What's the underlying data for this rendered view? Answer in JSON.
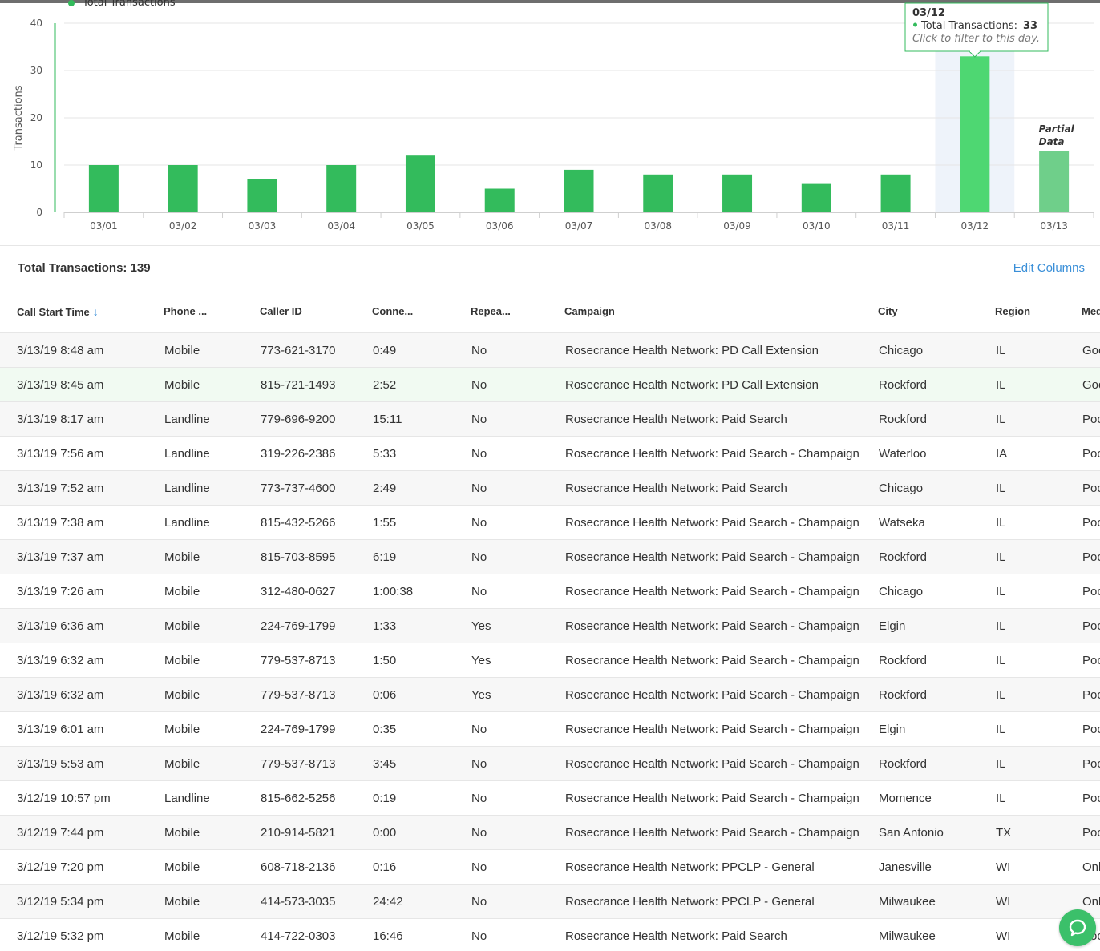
{
  "chart_data": {
    "type": "bar",
    "legend_label": "Total Transactions",
    "ylabel": "Transactions",
    "ylim": [
      0,
      40
    ],
    "yticks": [
      0,
      10,
      20,
      30,
      40
    ],
    "categories": [
      "03/01",
      "03/02",
      "03/03",
      "03/04",
      "03/05",
      "03/06",
      "03/07",
      "03/08",
      "03/09",
      "03/10",
      "03/11",
      "03/12",
      "03/13"
    ],
    "series": [
      {
        "name": "Total Transactions",
        "values": [
          10,
          10,
          7,
          10,
          12,
          5,
          9,
          8,
          8,
          6,
          8,
          33,
          13
        ]
      }
    ],
    "highlighted_category": "03/12",
    "partial_category": "03/13",
    "partial_label_line1": "Partial",
    "partial_label_line2": "Data",
    "tooltip": {
      "date": "03/12",
      "label": "Total Transactions:",
      "value": "33",
      "hint": "Click to filter to this day."
    },
    "colors": {
      "bar": "#33bb5c",
      "bar_highlight": "#4ed772",
      "bar_partial": "#6fcf8a",
      "highlight_band": "#eef3fa"
    }
  },
  "summary": {
    "total_text": "Total Transactions: 139",
    "edit_columns": "Edit Columns"
  },
  "table": {
    "columns": [
      "Call Start Time",
      "Phone ...",
      "Caller ID",
      "Conne...",
      "Repea...",
      "Campaign",
      "City",
      "Region",
      "Med"
    ],
    "sort_icon": "arrow-down-icon",
    "rows": [
      [
        "3/13/19 8:48 am",
        "Mobile",
        "773-621-3170",
        "0:49",
        "No",
        "Rosecrance Health Network: PD Call Extension",
        "Chicago",
        "IL",
        "Goo"
      ],
      [
        "3/13/19 8:45 am",
        "Mobile",
        "815-721-1493",
        "2:52",
        "No",
        "Rosecrance Health Network: PD Call Extension",
        "Rockford",
        "IL",
        "Goo"
      ],
      [
        "3/13/19 8:17 am",
        "Landline",
        "779-696-9200",
        "15:11",
        "No",
        "Rosecrance Health Network: Paid Search",
        "Rockford",
        "IL",
        "Poc"
      ],
      [
        "3/13/19 7:56 am",
        "Landline",
        "319-226-2386",
        "5:33",
        "No",
        "Rosecrance Health Network: Paid Search - Champaign",
        "Waterloo",
        "IA",
        "Poc"
      ],
      [
        "3/13/19 7:52 am",
        "Landline",
        "773-737-4600",
        "2:49",
        "No",
        "Rosecrance Health Network: Paid Search",
        "Chicago",
        "IL",
        "Poc"
      ],
      [
        "3/13/19 7:38 am",
        "Landline",
        "815-432-5266",
        "1:55",
        "No",
        "Rosecrance Health Network: Paid Search - Champaign",
        "Watseka",
        "IL",
        "Poc"
      ],
      [
        "3/13/19 7:37 am",
        "Mobile",
        "815-703-8595",
        "6:19",
        "No",
        "Rosecrance Health Network: Paid Search - Champaign",
        "Rockford",
        "IL",
        "Poc"
      ],
      [
        "3/13/19 7:26 am",
        "Mobile",
        "312-480-0627",
        "1:00:38",
        "No",
        "Rosecrance Health Network: Paid Search - Champaign",
        "Chicago",
        "IL",
        "Poc"
      ],
      [
        "3/13/19 6:36 am",
        "Mobile",
        "224-769-1799",
        "1:33",
        "Yes",
        "Rosecrance Health Network: Paid Search - Champaign",
        "Elgin",
        "IL",
        "Poc"
      ],
      [
        "3/13/19 6:32 am",
        "Mobile",
        "779-537-8713",
        "1:50",
        "Yes",
        "Rosecrance Health Network: Paid Search - Champaign",
        "Rockford",
        "IL",
        "Poc"
      ],
      [
        "3/13/19 6:32 am",
        "Mobile",
        "779-537-8713",
        "0:06",
        "Yes",
        "Rosecrance Health Network: Paid Search - Champaign",
        "Rockford",
        "IL",
        "Poc"
      ],
      [
        "3/13/19 6:01 am",
        "Mobile",
        "224-769-1799",
        "0:35",
        "No",
        "Rosecrance Health Network: Paid Search - Champaign",
        "Elgin",
        "IL",
        "Poc"
      ],
      [
        "3/13/19 5:53 am",
        "Mobile",
        "779-537-8713",
        "3:45",
        "No",
        "Rosecrance Health Network: Paid Search - Champaign",
        "Rockford",
        "IL",
        "Poc"
      ],
      [
        "3/12/19 10:57 pm",
        "Landline",
        "815-662-5256",
        "0:19",
        "No",
        "Rosecrance Health Network: Paid Search - Champaign",
        "Momence",
        "IL",
        "Poc"
      ],
      [
        "3/12/19 7:44 pm",
        "Mobile",
        "210-914-5821",
        "0:00",
        "No",
        "Rosecrance Health Network: Paid Search - Champaign",
        "San Antonio",
        "TX",
        "Poc"
      ],
      [
        "3/12/19 7:20 pm",
        "Mobile",
        "608-718-2136",
        "0:16",
        "No",
        "Rosecrance Health Network: PPCLP - General",
        "Janesville",
        "WI",
        "Onl"
      ],
      [
        "3/12/19 5:34 pm",
        "Mobile",
        "414-573-3035",
        "24:42",
        "No",
        "Rosecrance Health Network: PPCLP - General",
        "Milwaukee",
        "WI",
        "Onl"
      ],
      [
        "3/12/19 5:32 pm",
        "Mobile",
        "414-722-0303",
        "16:46",
        "No",
        "Rosecrance Health Network: Paid Search",
        "Milwaukee",
        "WI",
        "Poc"
      ]
    ]
  },
  "chat": {
    "icon": "chat-bubble-icon",
    "color": "#3bc06a"
  }
}
